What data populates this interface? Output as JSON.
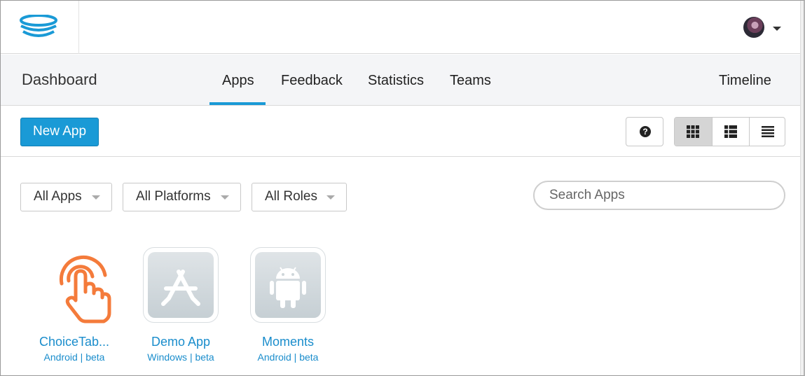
{
  "nav": {
    "title": "Dashboard",
    "tabs": [
      "Apps",
      "Feedback",
      "Statistics",
      "Teams"
    ],
    "timeline": "Timeline",
    "active_tab": "Apps"
  },
  "toolbar": {
    "new_app_label": "New App",
    "help_icon": "question-circle-icon",
    "view_icons": [
      "grid-view-icon",
      "list-view-icon",
      "compact-list-view-icon"
    ],
    "active_view": "grid"
  },
  "filters": {
    "apps": "All Apps",
    "platforms": "All Platforms",
    "roles": "All Roles",
    "search_placeholder": "Search Apps"
  },
  "apps": [
    {
      "name": "ChoiceTab...",
      "platform": "Android",
      "release": "beta",
      "meta": "Android | beta",
      "icon": "tap-hand-icon"
    },
    {
      "name": "Demo App",
      "platform": "Windows",
      "release": "beta",
      "meta": "Windows | beta",
      "icon": "app-store-placeholder-icon"
    },
    {
      "name": "Moments",
      "platform": "Android",
      "release": "beta",
      "meta": "Android | beta",
      "icon": "android-placeholder-icon"
    }
  ],
  "colors": {
    "accent": "#1a9ad6",
    "link": "#1a8dcc",
    "app_icon_orange": "#f47b3b",
    "navbar_bg": "#f4f5f7"
  }
}
